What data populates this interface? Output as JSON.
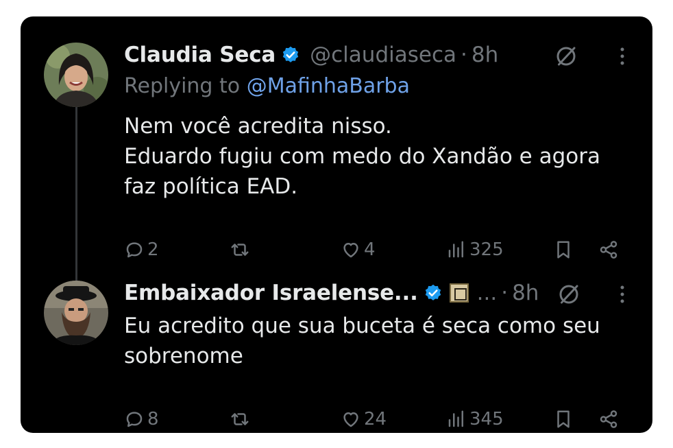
{
  "tweets": [
    {
      "name": "Claudia Seca",
      "handle": "@claudiaseca",
      "time": "8h",
      "replying_prefix": "Replying to",
      "replying_to": "@MafinhaBarba",
      "text_lines": [
        "Nem você acredita nisso.",
        "Eduardo fugiu com medo do Xandão e agora",
        "faz política EAD."
      ],
      "replies": "2",
      "reposts": "",
      "likes": "4",
      "views": "325"
    },
    {
      "name": "Embaixador Israelense...",
      "handle": "...",
      "time": "8h",
      "text_lines": [
        "Eu acredito que sua buceta é seca como seu",
        "sobrenome"
      ],
      "replies": "8",
      "reposts": "",
      "likes": "24",
      "views": "345"
    }
  ],
  "colors": {
    "background": "#000000",
    "text_primary": "#e7e9ea",
    "text_secondary": "#71767b",
    "link": "#6fa2e8",
    "verified": "#1d9bf0"
  },
  "icons": [
    "verified-badge-icon",
    "grok-icon",
    "more-icon",
    "reply-icon",
    "repost-icon",
    "like-icon",
    "views-icon",
    "bookmark-icon",
    "share-icon"
  ]
}
